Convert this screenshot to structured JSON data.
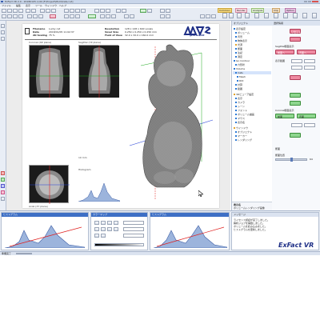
{
  "window": {
    "title": "ExFact VR 2.0 - 20180105.rvd4 [F:\\Project\\Mold\\Cats.rvd]"
  },
  "menu": [
    "ファイル",
    "編集",
    "表示",
    "ツール",
    "ウィンドウ",
    "ヘルプ"
  ],
  "tabs": [
    "Common",
    "Render",
    "Analysis",
    "Clip",
    "Option"
  ],
  "logo": {
    "brand": "ExFact VR"
  },
  "report": {
    "fields": [
      {
        "label": "Filename",
        "value": "Lucky cat"
      },
      {
        "label": "Date",
        "value": "2018/01/05 11:02:37"
      },
      {
        "label": "2D Scaling",
        "value": "75 %"
      }
    ],
    "fields2": [
      {
        "label": "Resolution",
        "value": "128 x 128 x 640 voxels"
      },
      {
        "label": "Voxel Size",
        "value": "0.250 x 0.250 x 0.250 mm"
      },
      {
        "label": "Field of View",
        "value": "32.0 x 32.0 x 160.0 mm"
      }
    ],
    "panels": {
      "coronal": "Coronal (XZ plane)",
      "sagittal": "Sagittal (YZ plane)",
      "axial": "Axial (XY plane)",
      "histogram": "Histogram"
    },
    "scale_note": "10 mm"
  },
  "tree": {
    "title": "オブジェクト",
    "items": [
      "表示設定",
      "ボリューム",
      "背景",
      "物体表示",
      "光源",
      "断面",
      "注記",
      "測定",
      "Iso Contour",
      "穴形状",
      "Volume",
      "Cats",
      "Mesh",
      "ROI",
      "計算",
      "範囲",
      "3Dビューア設定",
      "表示",
      "カメラ",
      "シーン",
      "フォント",
      "ボリューム描画",
      "マウス",
      "表示名",
      "ウインドウ",
      "オブジェクト",
      "マーカー",
      "レンダリング"
    ],
    "footer_label": "表示名",
    "footer_value": "ボリュームレンダリング画像"
  },
  "props": {
    "title": "選択情報",
    "reset": "リセット",
    "mode": "Sagittal断面表示",
    "btn_a": "前面へ",
    "btn_b": "背面へ",
    "level_label": "表示範囲",
    "section2": "Coronal断面表示",
    "btn_c": "前面",
    "btn_d": "背面",
    "section3": "断面",
    "slider_label": "断面位置",
    "slider_value": "64"
  },
  "bottom": {
    "panel_titles": [
      "ヒストグラム",
      "カラーマップ",
      "ヒストグラム"
    ],
    "messages_title": "メッセージ",
    "messages": [
      "ライセンス認証が完了しました。",
      "解析ジョブを開始しました。",
      "ボリュームを読み込みました。",
      "ヒストグラムを更新しました。"
    ]
  },
  "status": {
    "text": "準備完了",
    "progress": 0.08
  },
  "colors": {
    "accent_pink": "#ee8aa1",
    "accent_green": "#8fd68f",
    "histogram_fill": "#9cb4dc",
    "guide_red": "#e0201f",
    "guide_green": "#1fa81f",
    "guide_blue": "#2a45d8"
  },
  "icons": [
    "app-icon",
    "window-minimize-icon",
    "window-maximize-icon",
    "window-close-icon",
    "mouse-cursor-icon"
  ]
}
